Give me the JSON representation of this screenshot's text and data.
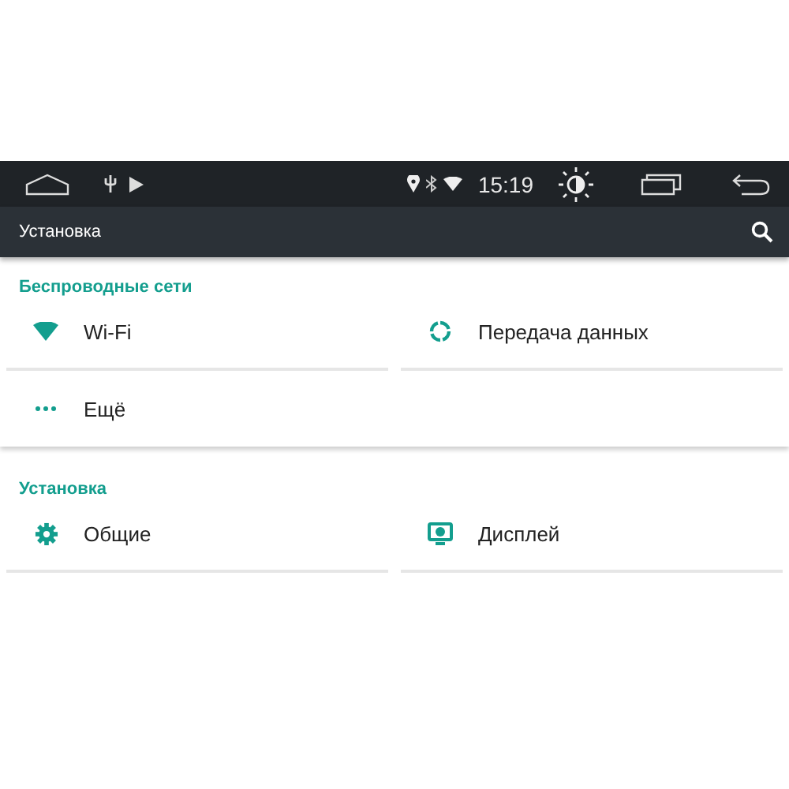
{
  "status_bar": {
    "time": "15:19"
  },
  "toolbar": {
    "title": "Установка"
  },
  "sections": [
    {
      "title": "Беспроводные сети",
      "items": [
        {
          "label": "Wi-Fi",
          "kind": "wifi"
        },
        {
          "label": "Передача данных",
          "kind": "data"
        },
        {
          "label": "Ещё",
          "kind": "more"
        }
      ]
    },
    {
      "title": "Установка",
      "items": [
        {
          "label": "Общие",
          "kind": "gear"
        },
        {
          "label": "Дисплей",
          "kind": "display"
        }
      ]
    }
  ]
}
